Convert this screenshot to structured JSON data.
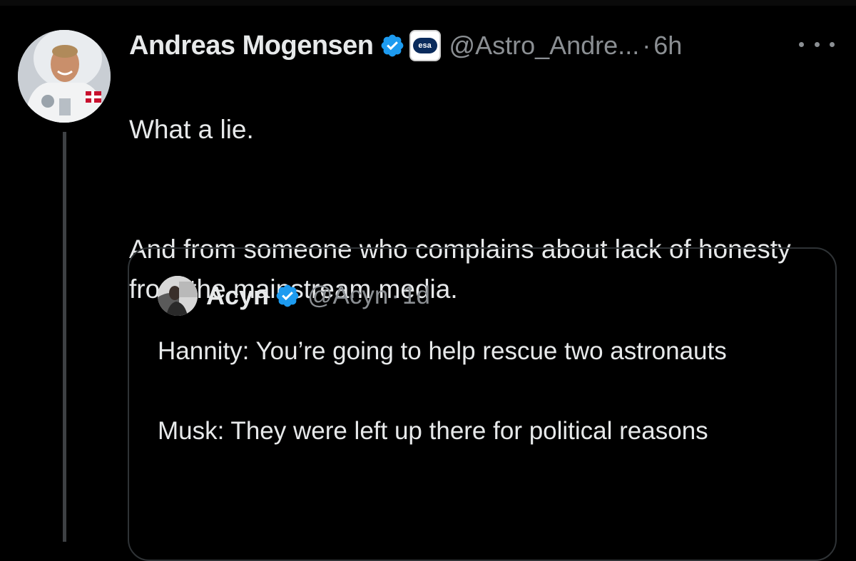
{
  "tweet": {
    "author_name": "Andreas Mogensen",
    "verified_icon": "verified-badge-icon",
    "affiliate_badge_text": "esa",
    "handle": "@Astro_Andre...",
    "separator": "·",
    "time": "6h",
    "more_icon": "more-options-icon",
    "text_lines": [
      "What a lie.",
      "And from someone who complains about lack of honesty from the mainstream media."
    ]
  },
  "quote": {
    "author_name": "Acyn",
    "verified_icon": "verified-badge-icon",
    "handle": "@Acyn",
    "separator": "·",
    "time": "1d",
    "text_lines": [
      "Hannity: You’re going to help rescue two astronauts",
      "Musk: They were left up there for political reasons"
    ]
  },
  "colors": {
    "background": "#000000",
    "primary_text": "#e7e9ea",
    "secondary_text": "#8b8f93",
    "verified_blue": "#1d9bf0",
    "border": "#2f3336",
    "thread_line": "#3e4144"
  }
}
